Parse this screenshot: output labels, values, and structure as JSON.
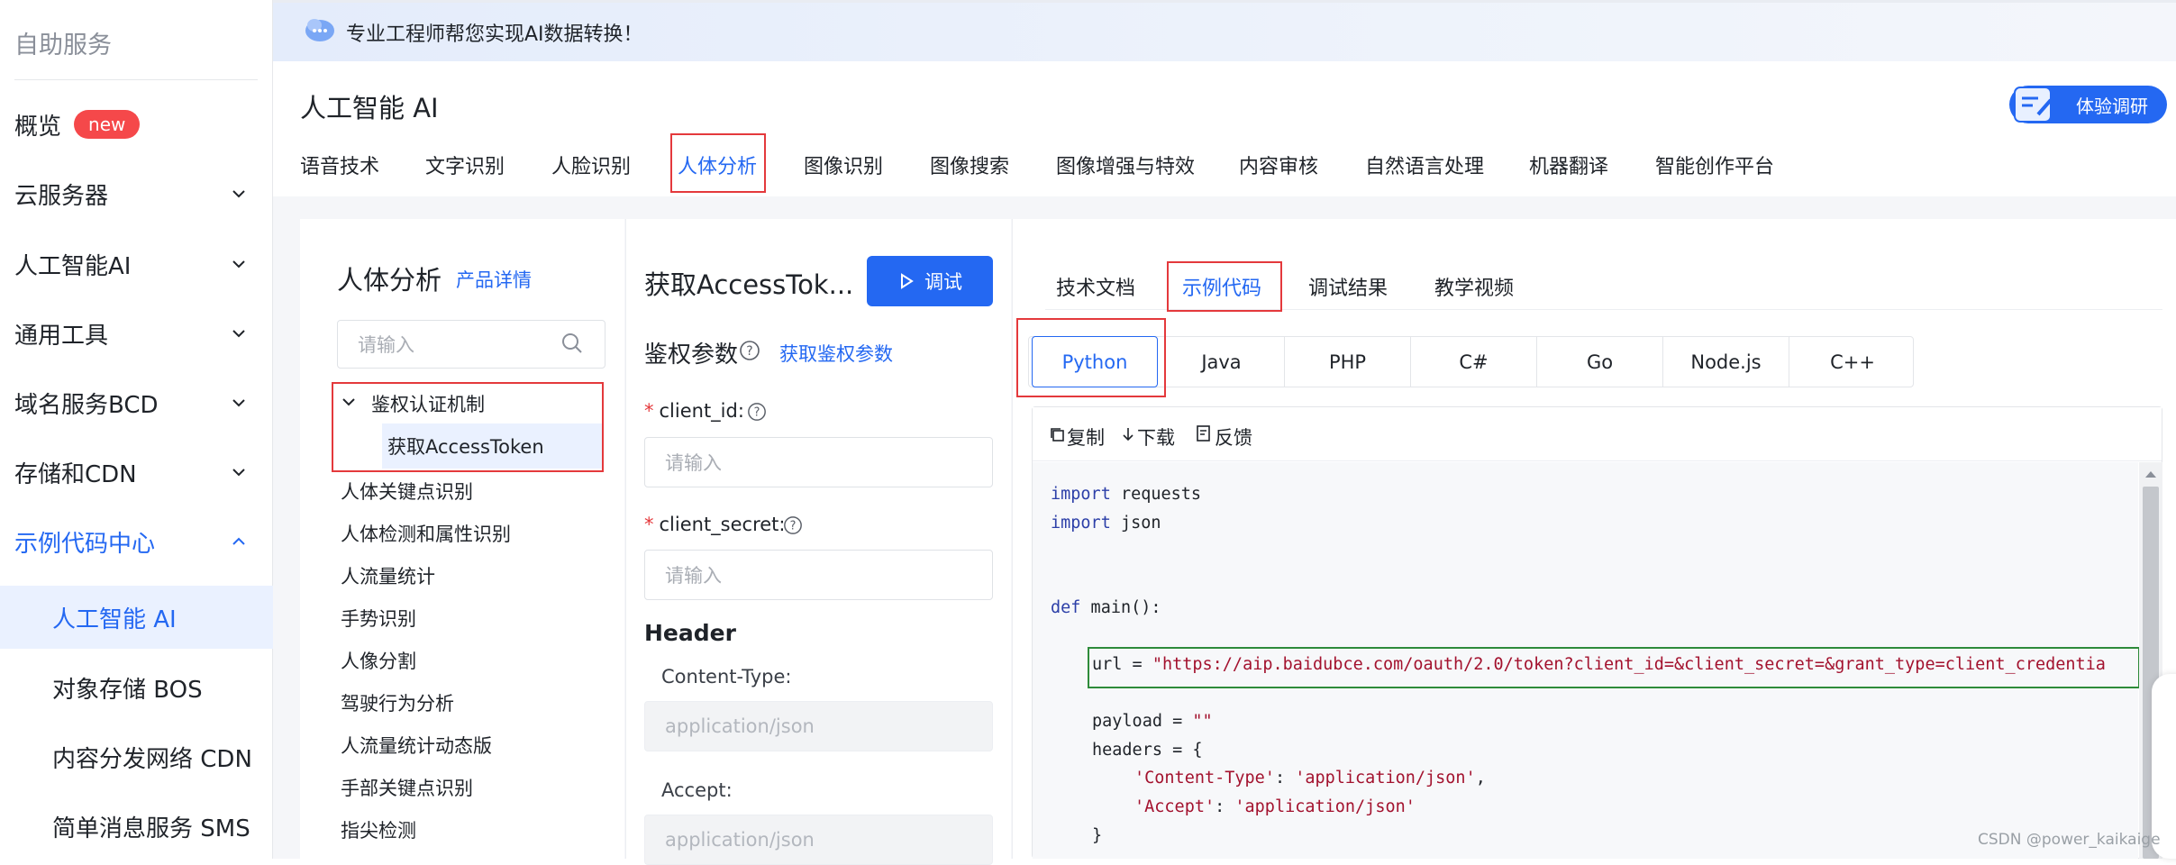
{
  "sidebar": {
    "heading": "自助服务",
    "items": [
      {
        "label": "概览",
        "badge": "new"
      },
      {
        "label": "云服务器"
      },
      {
        "label": "人工智能AI"
      },
      {
        "label": "通用工具"
      },
      {
        "label": "域名服务BCD"
      },
      {
        "label": "存储和CDN"
      },
      {
        "label": "示例代码中心"
      }
    ],
    "subitems": [
      {
        "label": "人工智能 AI"
      },
      {
        "label": "对象存储 BOS"
      },
      {
        "label": "内容分发网络 CDN"
      },
      {
        "label": "简单消息服务 SMS"
      }
    ]
  },
  "banner": {
    "text": "专业工程师帮您实现AI数据转换！"
  },
  "header": {
    "title": "人工智能 AI",
    "survey_label": "体验调研",
    "tabs": [
      "语音技术",
      "文字识别",
      "人脸识别",
      "人体分析",
      "图像识别",
      "图像搜索",
      "图像增强与特效",
      "内容审核",
      "自然语言处理",
      "机器翻译",
      "智能创作平台"
    ]
  },
  "left_panel": {
    "title": "人体分析",
    "detail_link": "产品详情",
    "search_placeholder": "请输入",
    "tree_parent": "鉴权认证机制",
    "tree_child": "获取AccessToken",
    "items": [
      "人体关键点识别",
      "人体检测和属性识别",
      "人流量统计",
      "手势识别",
      "人像分割",
      "驾驶行为分析",
      "人流量统计动态版",
      "手部关键点识别",
      "指尖检测"
    ]
  },
  "mid_panel": {
    "title": "获取AccessTok...",
    "debug_label": "调试",
    "auth_section": "鉴权参数",
    "auth_link": "获取鉴权参数",
    "client_id_label": "client_id:",
    "client_id_placeholder": "请输入",
    "client_secret_label": "client_secret:",
    "client_secret_placeholder": "请输入",
    "header_section": "Header",
    "content_type_label": "Content-Type:",
    "content_type_value": "application/json",
    "accept_label": "Accept:",
    "accept_value": "application/json"
  },
  "right_panel": {
    "tabs": [
      "技术文档",
      "示例代码",
      "调试结果",
      "教学视频"
    ],
    "languages": [
      "Python",
      "Java",
      "PHP",
      "C#",
      "Go",
      "Node.js",
      "C++"
    ],
    "tools": {
      "copy": "复制",
      "download": "下载",
      "feedback": "反馈"
    },
    "code": {
      "l1_kw": "import",
      "l1_rest": " requests",
      "l2_kw": "import",
      "l2_rest": " json",
      "l3_kw": "def",
      "l3_rest": " main():",
      "l4_pre": "url = ",
      "l4_str": "\"https://aip.baidubce.com/oauth/2.0/token?client_id=&client_secret=&grant_type=client_credentia",
      "l5_pre": "payload = ",
      "l5_str": "\"\"",
      "l6": "headers = {",
      "l7_k": "'Content-Type'",
      "l7_v": "'application/json'",
      "l8_k": "'Accept'",
      "l8_v": "'application/json'",
      "l9": "}"
    }
  },
  "watermark": "CSDN @power_kaikaige",
  "colors": {
    "accent": "#2468f2",
    "highlight_red": "#e4393c",
    "highlight_green": "#2e8b3a",
    "badge": "#f5484a"
  }
}
